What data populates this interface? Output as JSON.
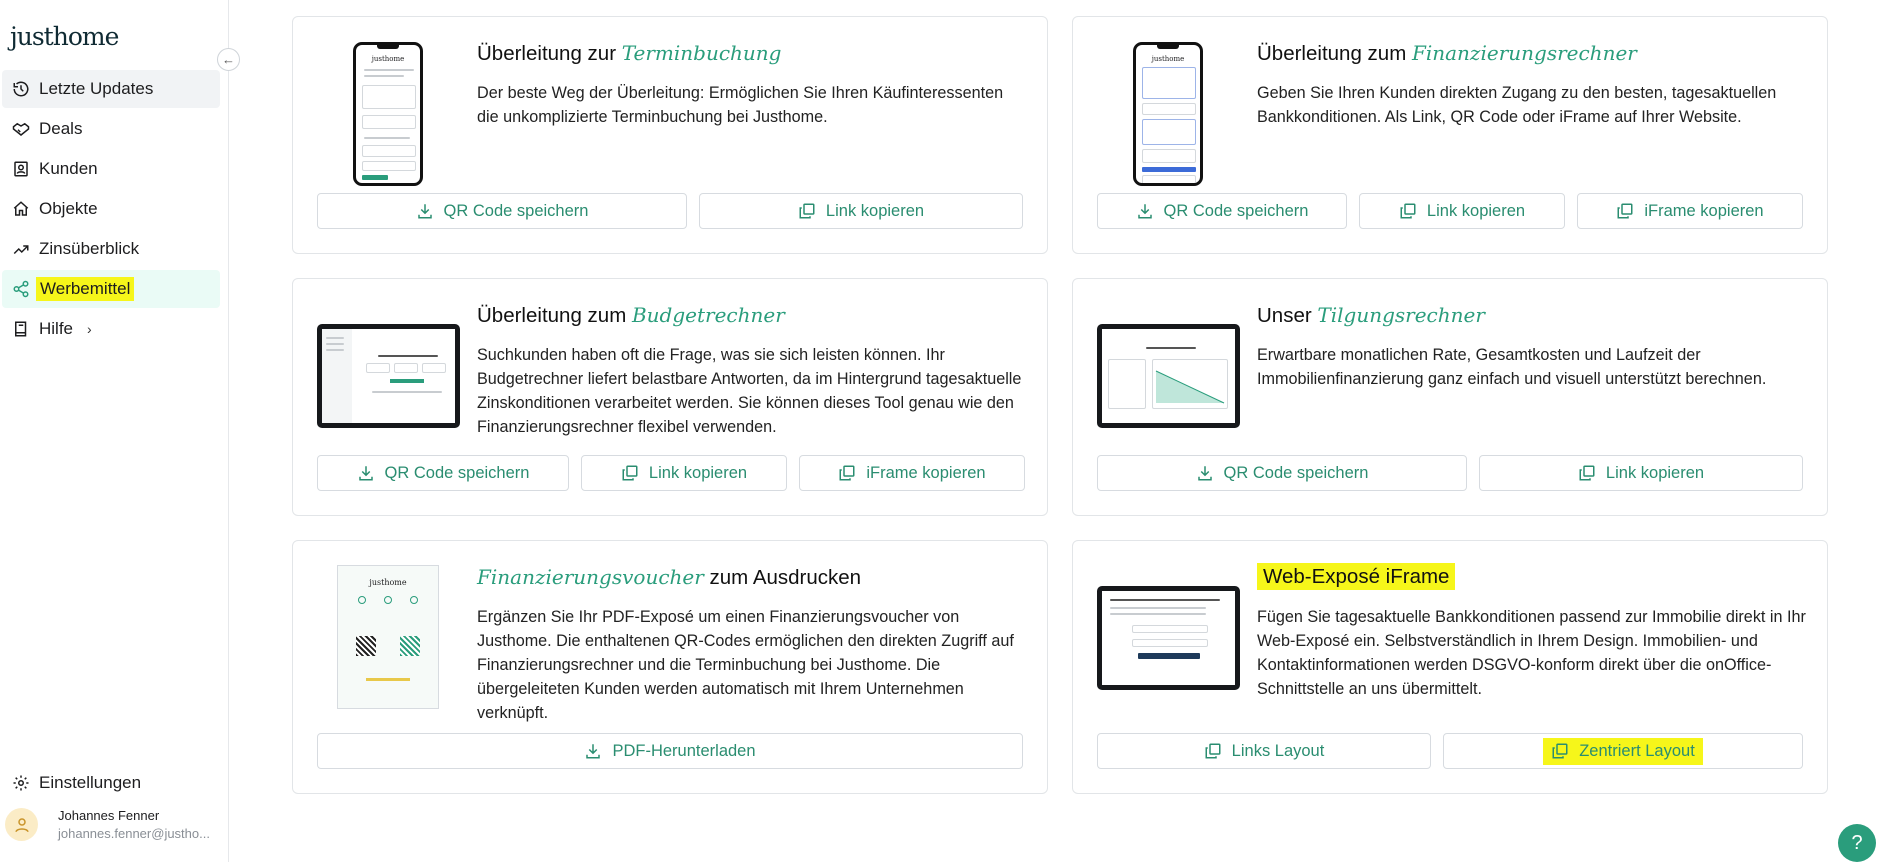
{
  "brand": {
    "logo_text": "justhome"
  },
  "sidebar": {
    "items": [
      {
        "label": "Letzte Updates",
        "icon": "history-icon"
      },
      {
        "label": "Deals",
        "icon": "handshake-icon"
      },
      {
        "label": "Kunden",
        "icon": "contacts-icon"
      },
      {
        "label": "Objekte",
        "icon": "home-icon"
      },
      {
        "label": "Zinsüberblick",
        "icon": "trend-up-icon"
      },
      {
        "label": "Werbemittel",
        "icon": "share-icon"
      },
      {
        "label": "Hilfe",
        "icon": "book-icon"
      }
    ],
    "settings_label": "Einstellungen",
    "user": {
      "name": "Johannes Fenner",
      "email": "johannes.fenner@justho..."
    }
  },
  "cards": [
    {
      "title_prefix": "Überleitung zur ",
      "title_em": "Terminbuchung",
      "title_suffix": "",
      "description": "Der beste Weg der Überleitung: Ermöglichen Sie Ihren Käufinteressenten die unkomplizierte Terminbuchung bei Justhome.",
      "buttons": [
        "QR Code speichern",
        "Link kopieren"
      ]
    },
    {
      "title_prefix": "Überleitung zum ",
      "title_em": "Finanzierungsrechner",
      "title_suffix": "",
      "description": "Geben Sie Ihren Kunden direkten Zugang zu den besten, tagesaktuellen Bankkonditionen. Als Link, QR Code oder iFrame auf Ihrer Website.",
      "buttons": [
        "QR Code speichern",
        "Link kopieren",
        "iFrame kopieren"
      ]
    },
    {
      "title_prefix": "Überleitung zum ",
      "title_em": "Budgetrechner",
      "title_suffix": "",
      "description": "Suchkunden haben oft die Frage, was sie sich leisten können. Ihr Budgetrechner liefert belastbare Antworten, da im Hintergrund tagesaktuelle Zinskonditionen verarbeitet werden. Sie können dieses Tool genau wie den Finanzierungsrechner flexibel verwenden.",
      "buttons": [
        "QR Code speichern",
        "Link kopieren",
        "iFrame kopieren"
      ]
    },
    {
      "title_prefix": "Unser ",
      "title_em": "Tilgungsrechner",
      "title_suffix": "",
      "description": "Erwartbare monatlichen Rate, Gesamtkosten und Laufzeit der Immobilienfinanzierung ganz einfach und visuell unterstützt berechnen.",
      "buttons": [
        "QR Code speichern",
        "Link kopieren"
      ]
    },
    {
      "title_prefix": "",
      "title_em": "Finanzierungsvoucher",
      "title_suffix": " zum Ausdrucken",
      "description": "Ergänzen Sie Ihr PDF-Exposé um einen Finanzierungsvoucher von Justhome. Die enthaltenen QR-Codes ermöglichen den direkten Zugriff auf Finanzierungsrechner und die Terminbuchung bei Justhome. Die übergeleiteten Kunden werden automatisch mit Ihrem Unternehmen verknüpft.",
      "buttons": [
        "PDF-Herunterladen"
      ]
    },
    {
      "title_prefix": "Web-Exposé iFrame",
      "title_em": "",
      "title_suffix": "",
      "description": "Fügen Sie tagesaktuelle Bankkonditionen passend zur Immobilie direkt in Ihr Web-Exposé ein. Selbstverständlich in Ihrem Design. Immobilien- und Kontaktinformationen werden DSGVO-konform direkt über die onOffice-Schnittstelle an uns übermittelt.",
      "buttons": [
        "Links Layout",
        "Zentriert Layout"
      ]
    }
  ],
  "help_label": "?",
  "colors": {
    "accent": "#2a9d7c",
    "highlight": "#f6f61a",
    "active_bg": "#eafbf6"
  }
}
